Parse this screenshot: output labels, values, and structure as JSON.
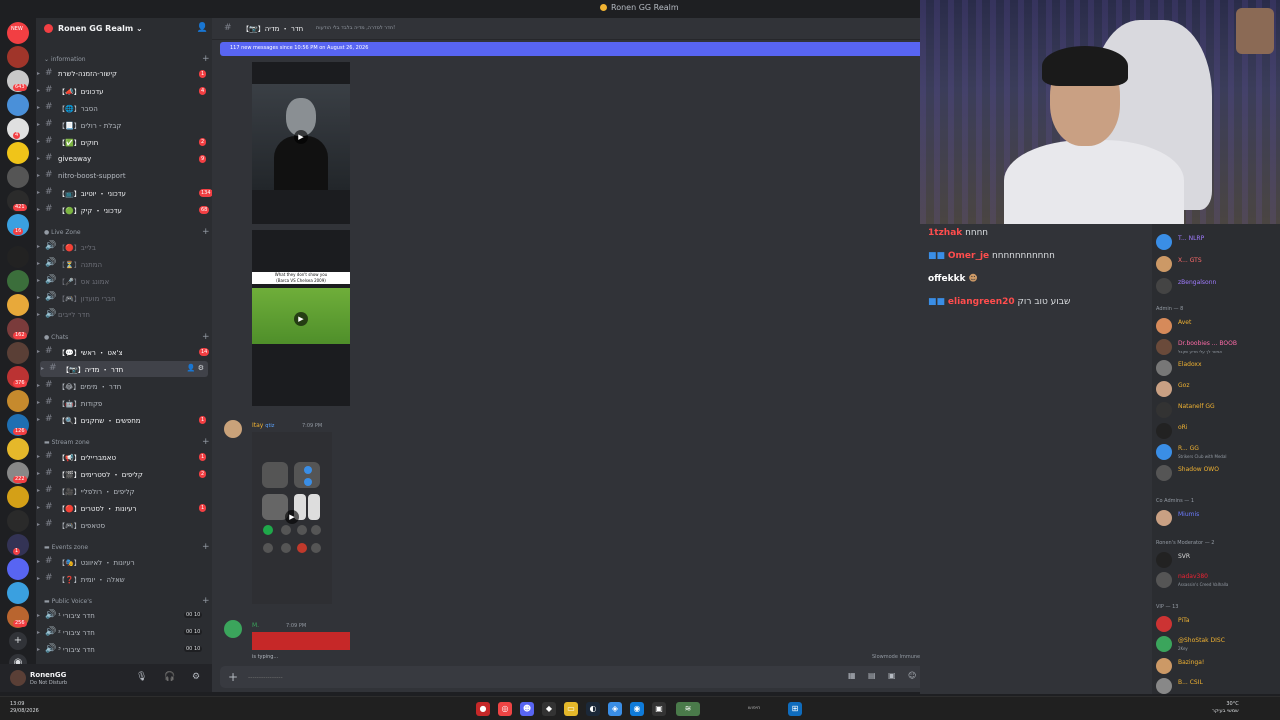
{
  "window": {
    "title": "Ronen GG Realm"
  },
  "server": {
    "name": "Ronen GG Realm"
  },
  "rail_badges": [
    "NEW",
    "643",
    "4",
    "421",
    "16",
    "162",
    "376",
    "126",
    "222",
    "1",
    "256"
  ],
  "categories": {
    "information": "information",
    "live_zone": "Live Zone",
    "chats": "Chats",
    "stream_zone": "Stream zone",
    "events_zone": "Events zone",
    "public_voices": "Public Voice's"
  },
  "channels": {
    "info": [
      {
        "label": "קישור-הזמנה-לשרת",
        "count": "1"
      },
      {
        "label": "【📣】עדכונים",
        "count": "4"
      },
      {
        "label": "【🌐】הסבר",
        "count": ""
      },
      {
        "label": "【📃】קבלת - רולים",
        "count": ""
      },
      {
        "label": "【✅】חוקים",
        "count": "2"
      },
      {
        "label": "giveaway",
        "count": "9"
      },
      {
        "label": "nitro-boost-support",
        "count": ""
      },
      {
        "label": "【📺】עדכוני ・ יוטיוב",
        "count": "134"
      },
      {
        "label": "【🟢】עדכוני ・ קיק",
        "count": "68"
      }
    ],
    "live": [
      {
        "label": "【🔴】בלייב"
      },
      {
        "label": "【⏳】המתנה"
      },
      {
        "label": "【🎤】אמונג אס"
      },
      {
        "label": "【🎮】חברי מועדון"
      },
      {
        "label": "חדר לייבים"
      }
    ],
    "chats": [
      {
        "label": "【💬】צ'אט ・ ראשי",
        "count": "14"
      },
      {
        "label": "【📷】חדר ・ מדיה",
        "count": ""
      },
      {
        "label": "【😂】חדר ・ מימים",
        "count": ""
      },
      {
        "label": "【🤖】פקודות",
        "count": ""
      },
      {
        "label": "【🔍】מחפשים ・ שחקנים",
        "count": "1"
      }
    ],
    "stream": [
      {
        "label": "【📢】טאמבריילים",
        "count": "1"
      },
      {
        "label": "【🎬】קליפים ・ לסטרימים",
        "count": "2"
      },
      {
        "label": "【🎥】קליפים ・ רולפליי",
        "count": ""
      },
      {
        "label": "【🔴】רעיונות ・ לסטרים",
        "count": "1"
      },
      {
        "label": "【🎮】סטאפים",
        "count": ""
      }
    ],
    "events": [
      {
        "label": "【🎭】רעיונות ・ לאיוונט"
      },
      {
        "label": "【❓】שאלה ・ יומית"
      }
    ],
    "voice": [
      {
        "label": "חדר ציבורי ¹",
        "users": "00 10"
      },
      {
        "label": "חדר ציבורי ²",
        "users": "00 10"
      },
      {
        "label": "חדר ציבורי ³",
        "users": "00 10"
      }
    ]
  },
  "user": {
    "name": "RonenGG",
    "status": "Do Not Disturb"
  },
  "chat": {
    "channel_name": "【📷】חדר ・ מדיה",
    "topic": "חדר לסדרה, מדיה בלבד בלי הודעות!",
    "new_messages_banner": "117 new messages since 10:56 PM on August 26, 2026",
    "video_caption_top": "What they don't show you",
    "video_caption_sub": "(Barca VS Chelsea 2009)",
    "message1": {
      "author": "Itay",
      "tag": "qtiz",
      "time": "7:09 PM"
    },
    "message2": {
      "author": "M.",
      "time": "7:09 PM"
    },
    "typing": "is typing...",
    "slowmode": "Slowmode Immune",
    "composer_placeholder": "----------------"
  },
  "stream_chat": [
    {
      "user": "1tzhak",
      "text": "nnnn",
      "color": "#ff4d4d"
    },
    {
      "user": "Omer_je",
      "text": "nnnnnnnnnnn",
      "color": "#ff4d4d"
    },
    {
      "user": "offekkk",
      "text": "",
      "color": "#ffffff"
    },
    {
      "user": "eliangreen20",
      "text": "שבוע טוב רוק",
      "color": "#ff4d4d"
    }
  ],
  "members": {
    "top": [
      {
        "name": "T... NLRP",
        "sub": ""
      },
      {
        "name": "X... GTS",
        "sub": ""
      },
      {
        "name": "zBengalsonn",
        "sub": ""
      }
    ],
    "admin_header": "Admin — 8",
    "admins": [
      {
        "name": "Avet",
        "sub": ""
      },
      {
        "name": "Dr.boobies ... BOOB",
        "sub": "אפשר לך עלי מדיע שקבל"
      },
      {
        "name": "Eladoxx",
        "sub": ""
      },
      {
        "name": "Goz",
        "sub": ""
      },
      {
        "name": "Natanelf GG",
        "sub": ""
      },
      {
        "name": "oRi",
        "sub": ""
      },
      {
        "name": "R... GG",
        "sub": "Strikers Club with Medal"
      },
      {
        "name": "Shadow OWO",
        "sub": ""
      }
    ],
    "coadmin_header": "Co Admins — 1",
    "coadmins": [
      {
        "name": "Miumis",
        "sub": ""
      }
    ],
    "mod_header": "Ronen's Moderator — 2",
    "mods": [
      {
        "name": "SVR",
        "sub": ""
      },
      {
        "name": "nadav380",
        "sub": "Assassin's Creed Valhalla"
      }
    ],
    "vip_header": "VIP — 13",
    "vips": [
      {
        "name": "PiTa",
        "sub": ""
      },
      {
        "name": "@ShoStak DISC",
        "sub": "2Key"
      },
      {
        "name": "Bazinga!",
        "sub": ""
      },
      {
        "name": "B... CSIL",
        "sub": ""
      }
    ]
  },
  "taskbar": {
    "time": "13:09",
    "date": "29/08/2026",
    "search": "חיפוש",
    "weather_temp": "30°C",
    "weather_desc": "שמשי בעיקר"
  }
}
